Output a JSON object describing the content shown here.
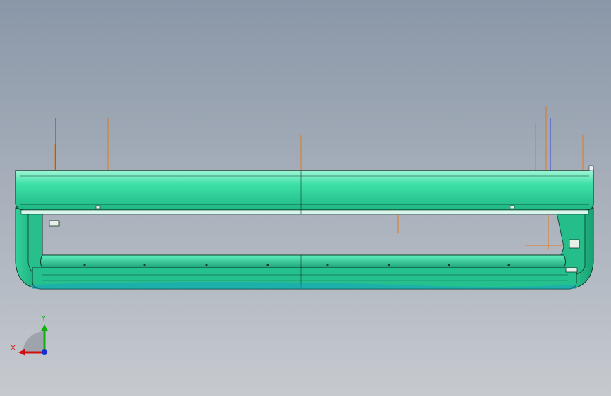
{
  "viewport": {
    "background_top": "#8a97a8",
    "background_bottom": "#c6cacf"
  },
  "model": {
    "body_color": "#2fd7a0",
    "body_light": "#7ff2c8",
    "edge_color": "#0d3b2a",
    "sketch_line_color": "#e07a1f",
    "axis_line_color": "#3040e0"
  },
  "triad": {
    "x_label": "X",
    "y_label": "Y",
    "x_color": "#d01010",
    "y_color": "#10b010",
    "z_color": "#1030d0",
    "icon": "coordinate-triad-icon"
  }
}
